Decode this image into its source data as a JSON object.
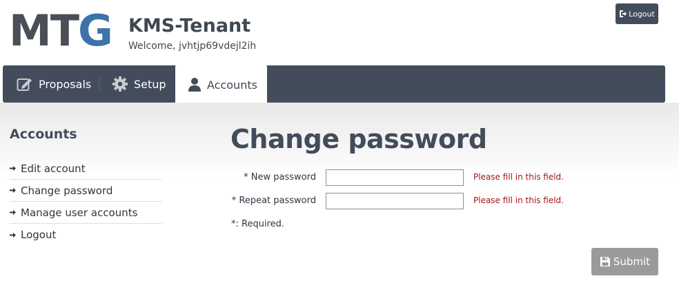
{
  "header": {
    "logo_main": "MT",
    "logo_accent": "G",
    "tenant_name": "KMS-Tenant",
    "welcome_text": "Welcome, jvhtjp69vdejl2ih",
    "logout_label": "Logout"
  },
  "nav": {
    "items": [
      {
        "label": "Proposals",
        "icon": "edit-icon"
      },
      {
        "label": "Setup",
        "icon": "gear-icon"
      },
      {
        "label": "Accounts",
        "icon": "user-icon",
        "active": true
      }
    ]
  },
  "sidebar": {
    "title": "Accounts",
    "items": [
      {
        "label": "Edit account"
      },
      {
        "label": "Change password"
      },
      {
        "label": "Manage user accounts"
      },
      {
        "label": "Logout"
      }
    ]
  },
  "main": {
    "title": "Change password",
    "fields": [
      {
        "label": "* New password",
        "value": "",
        "error": "Please fill in this field."
      },
      {
        "label": "* Repeat password",
        "value": "",
        "error": "Please fill in this field."
      }
    ],
    "required_note": "*: Required.",
    "submit_label": "Submit"
  },
  "colors": {
    "nav_bg": "#434c5b",
    "logo_accent": "#3d73a8",
    "error": "#a31515",
    "submit_bg": "#9a9a9a"
  }
}
